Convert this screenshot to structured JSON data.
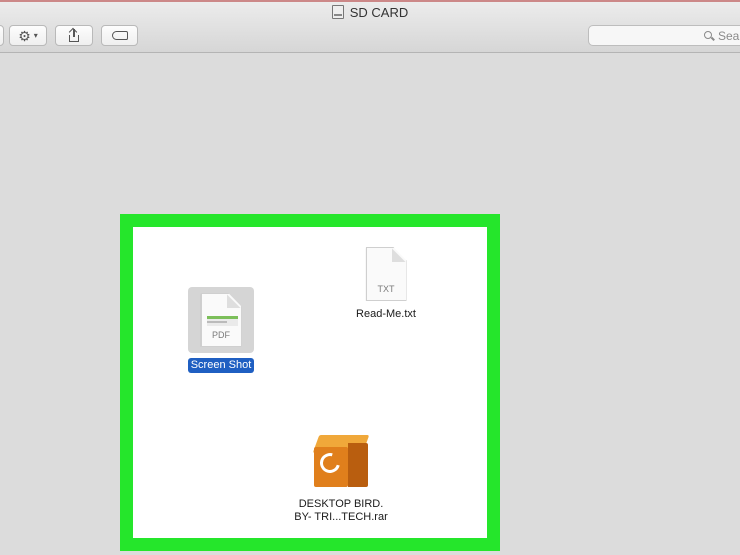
{
  "window": {
    "title": "SD CARD"
  },
  "toolbar": {
    "action_icon": "gear-icon",
    "share_icon": "share-icon",
    "tag_icon": "tag-icon"
  },
  "search": {
    "placeholder": "Sea"
  },
  "files": [
    {
      "name": "Screen Shot",
      "type": "PDF",
      "selected": true
    },
    {
      "name": "Read-Me.txt",
      "type": "TXT",
      "selected": false
    },
    {
      "name_line1": "DESKTOP BIRD.",
      "name_line2": "BY- TRI...TECH.rar",
      "type": "rar",
      "selected": false
    }
  ],
  "colors": {
    "highlight_frame": "#25e62b",
    "selection": "#1f5fc2",
    "archive": "#e07f1c"
  }
}
